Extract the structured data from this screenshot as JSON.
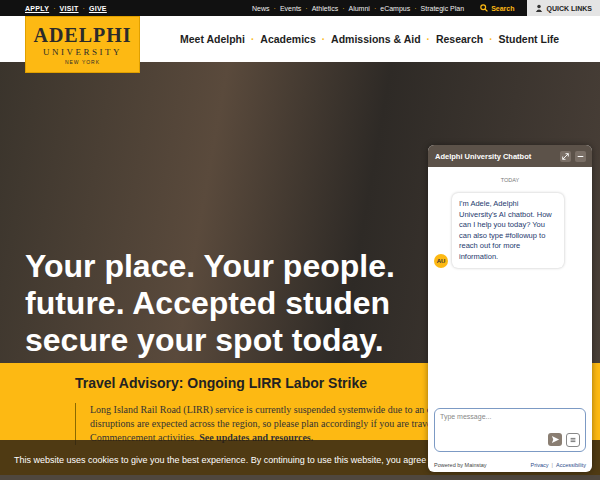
{
  "top_bar": {
    "left_links": [
      "APPLY",
      "VISIT",
      "GIVE"
    ],
    "separator": "·",
    "right_links": [
      "News",
      "Events",
      "Athletics",
      "Alumni",
      "eCampus",
      "Strategic Plan"
    ],
    "search": "Search",
    "quick_links": "QUICK LINKS"
  },
  "logo": {
    "name": "ADELPHI",
    "line2": "UNIVERSITY",
    "line3": "NEW YORK"
  },
  "nav": {
    "items": [
      "Meet Adelphi",
      "Academics",
      "Admissions & Aid",
      "Research",
      "Student Life"
    ],
    "separator": "·"
  },
  "hero": {
    "headline": [
      "Your place. Your people.",
      "future. Accepted studen",
      "secure your spot today."
    ]
  },
  "advisory": {
    "title": "Travel Advisory: Ongoing LIRR Labor Strike",
    "lines": [
      "Long Island Rail Road (LIRR) service is currently suspended systemwide due to an ong",
      "disruptions are expected across the region, so please plan accordingly if you are traveli"
    ],
    "last_line": "Commencement activities.",
    "link": "See updates and resources."
  },
  "cookie_bar": {
    "text": "This website uses cookies to give you the best experience. By continuing to use this website, you agree to our use of coo"
  },
  "chat": {
    "title": "Adelphi University Chatbot",
    "day_label": "TODAY",
    "messages": [
      {
        "from": "bot",
        "avatar": "AU",
        "text": "I'm Adele, Adelphi University's AI chatbot. How can I help you today? You can also type #followup to reach out for more information."
      }
    ],
    "input_placeholder": "Type message...",
    "footer": [
      "Powered by Mainstay",
      "Privacy",
      "Accessibility"
    ],
    "footer_separator": "|"
  }
}
